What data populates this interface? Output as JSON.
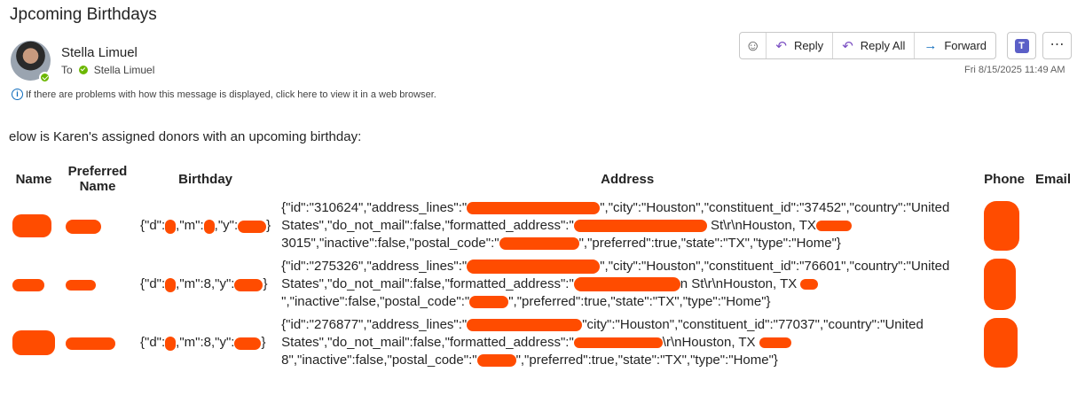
{
  "subject": "Jpcoming Birthdays",
  "sender": {
    "name": "Stella Limuel",
    "to_label": "To",
    "to_name": "Stella Limuel"
  },
  "info_text": "If there are problems with how this message is displayed, click here to view it in a web browser.",
  "actions": {
    "reply": "Reply",
    "reply_all": "Reply All",
    "forward": "Forward"
  },
  "date": "Fri 8/15/2025 11:49 AM",
  "intro": "elow is Karen's assigned donors with an upcoming birthday:",
  "table": {
    "headers": {
      "name": "Name",
      "preferred": "Preferred Name",
      "birthday": "Birthday",
      "address": "Address",
      "phone": "Phone",
      "email": "Email"
    },
    "rows": [
      {
        "name": "...",
        "bday": [
          "{\"d\":",
          ",\"m\":",
          ",\"y\":",
          "}"
        ],
        "addr": [
          "{\"id\":\"310624\",\"address_lines\":\"",
          "\",\"city\":\"Houston\",\"constituent_id\":\"37452\",\"country\":\"United States\",\"do_not_mail\":false,\"formatted_address\":\"",
          "St\\r\\nHouston, TX",
          "3015\",\"inactive\":false,\"postal_code\":\"",
          "\",\"preferred\":true,\"state\":\"TX\",\"type\":\"Home\"}"
        ]
      },
      {
        "name": "...",
        "bday": [
          "{\"d\":",
          ",\"m\":8,\"y\":",
          "}"
        ],
        "addr": [
          "{\"id\":\"275326\",\"address_lines\":\"",
          "\",\"city\":\"Houston\",\"constituent_id\":\"76601\",\"country\":\"United States\",\"do_not_mail\":false,\"formatted_address\":\"",
          "n St\\r\\nHouston, TX",
          "\",\"inactive\":false,\"postal_code\":\"",
          "\",\"preferred\":true,\"state\":\"TX\",\"type\":\"Home\"}"
        ]
      },
      {
        "name": "...",
        "bday": [
          "{\"d\":",
          ",\"m\":8,\"y\":",
          "}"
        ],
        "addr": [
          "{\"id\":\"276877\",\"address_lines\":\"",
          "\"city\":\"Houston\",\"constituent_id\":\"77037\",\"country\":\"United States\",\"do_not_mail\":false,\"formatted_address\":\"",
          "\\r\\nHouston, TX",
          "8\",\"inactive\":false,\"postal_code\":\"",
          "\",\"preferred\":true,\"state\":\"TX\",\"type\":\"Home\"}"
        ]
      }
    ]
  },
  "colors": {
    "redaction": "#ff4c00",
    "link": "#0f6cbd",
    "presence": "#6bb700"
  }
}
